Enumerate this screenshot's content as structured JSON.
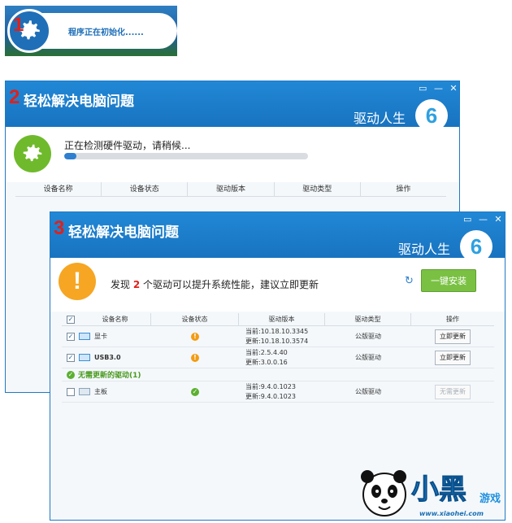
{
  "splash": {
    "step": "1",
    "message": "程序正在初始化......"
  },
  "window2": {
    "step": "2",
    "title": "轻松解决电脑问题",
    "brand": "驱动人生",
    "brand_logo": "6",
    "controls": [
      "▭",
      "—",
      "✕"
    ],
    "detecting_text": "正在检测硬件驱动，请稍候...",
    "progress": 0.05,
    "columns": [
      "设备名称",
      "设备状态",
      "驱动版本",
      "驱动类型",
      "操作"
    ]
  },
  "window3": {
    "step": "3",
    "title": "轻松解决电脑问题",
    "brand": "驱动人生",
    "brand_logo": "6",
    "controls": [
      "▭",
      "—",
      "✕"
    ],
    "found_prefix": "发现",
    "found_count": "2",
    "found_suffix": "个驱动可以提升系统性能，建议立即更新",
    "install_button": "一键安装",
    "columns": [
      "设备名称",
      "设备状态",
      "驱动版本",
      "驱动类型",
      "操作"
    ],
    "rows": [
      {
        "name": "显卡",
        "checked": true,
        "status": "warning",
        "current": "当前:10.18.10.3345",
        "update": "更新:10.18.10.3574",
        "type": "公版驱动",
        "action": "立即更新"
      },
      {
        "name": "USB3.0",
        "checked": true,
        "status": "warning",
        "current": "当前:2.5.4.40",
        "update": "更新:3.0.0.16",
        "type": "公版驱动",
        "action": "立即更新"
      }
    ],
    "no_update_section": "无需更新的驱动(1)",
    "no_update_rows": [
      {
        "name": "主板",
        "checked": false,
        "status": "ok",
        "current": "当前:9.4.0.1023",
        "update": "更新:9.4.0.1023",
        "type": "公版驱动",
        "action": "无需更新"
      }
    ]
  },
  "watermark": {
    "brand": "小黑",
    "game": "游戏",
    "url": "www.xiaohei.com"
  },
  "colors": {
    "titlebar": "#1f79c5",
    "step_number": "#e0201a",
    "install_green": "#7ac143",
    "warning_orange": "#f39c12",
    "ok_green": "#5cb030"
  }
}
